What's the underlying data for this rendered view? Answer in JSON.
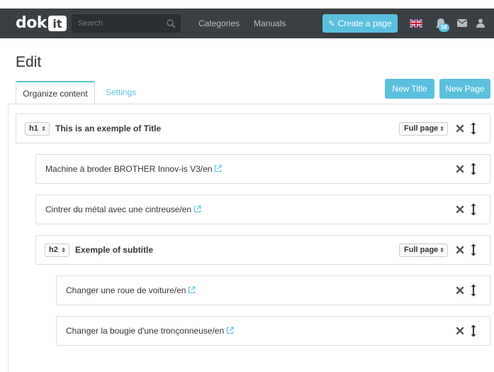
{
  "navbar": {
    "logo_text": "dok",
    "logo_badge": "it",
    "search_placeholder": "Search",
    "categories_label": "Categories",
    "manuals_label": "Manuals",
    "create_label": "Create a page",
    "notification_count": "58",
    "icons": [
      "search-icon",
      "pencil-icon",
      "uk-flag-icon",
      "bell-icon",
      "mail-icon",
      "user-icon"
    ]
  },
  "page": {
    "title": "Edit"
  },
  "tabs": [
    {
      "label": "Organize content",
      "active": true
    },
    {
      "label": "Settings",
      "active": false
    }
  ],
  "actions": {
    "new_title_label": "New Title",
    "new_page_label": "New Page"
  },
  "rows": [
    {
      "type": "title",
      "level": "h1",
      "text": "This is an exemple of Title",
      "page_option": "Full page"
    },
    {
      "type": "page",
      "text": "Machine à broder BROTHER Innov-is V3/en"
    },
    {
      "type": "page",
      "text": "Cintrer du métal avec une cintreuse/en"
    },
    {
      "type": "title",
      "level": "h2",
      "text": "Exemple of subtitle",
      "page_option": "Full page"
    },
    {
      "type": "page",
      "text": "Changer une roue de voiture/en"
    },
    {
      "type": "page",
      "text": "Changer la bougie d'une tronçonneuse/en"
    }
  ],
  "colors": {
    "navbar_bg": "#3a3f44",
    "accent": "#5bc0de",
    "row_border": "#dddddd"
  }
}
